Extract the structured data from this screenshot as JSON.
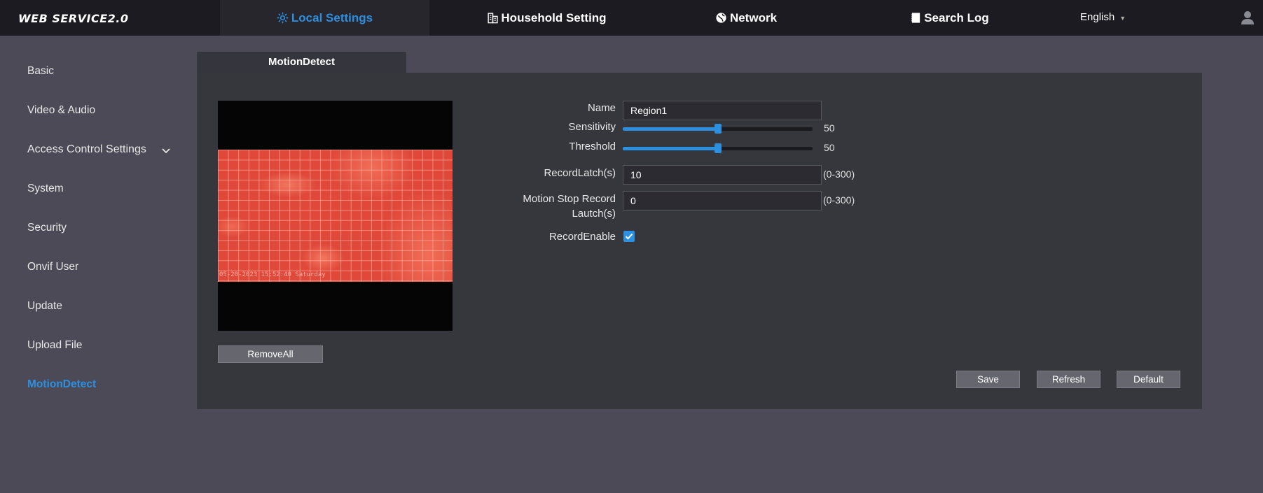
{
  "header": {
    "brand": "WEB SERVICE2.0",
    "nav": [
      {
        "label": "Local Settings",
        "icon": "gear-icon"
      },
      {
        "label": "Household Setting",
        "icon": "building-icon"
      },
      {
        "label": "Network",
        "icon": "globe-icon"
      },
      {
        "label": "Search Log",
        "icon": "document-icon"
      }
    ],
    "language": "English",
    "accent_color": "#2d8fe0"
  },
  "sidebar": {
    "items": [
      {
        "label": "Basic"
      },
      {
        "label": "Video & Audio"
      },
      {
        "label": "Access Control Settings"
      },
      {
        "label": "System"
      },
      {
        "label": "Security"
      },
      {
        "label": "Onvif User"
      },
      {
        "label": "Update"
      },
      {
        "label": "Upload File"
      },
      {
        "label": "MotionDetect"
      }
    ],
    "active": "MotionDetect"
  },
  "main": {
    "tab": "MotionDetect",
    "preview": {
      "overlay_text": "05-20-2023 15:52:40 Saturday"
    },
    "remove_all_label": "RemoveAll",
    "form": {
      "name_label": "Name",
      "name_value": "Region1",
      "sensitivity_label": "Sensitivity",
      "sensitivity_value": 50,
      "threshold_label": "Threshold",
      "threshold_value": 50,
      "record_latch_label": "RecordLatch(s)",
      "record_latch_value": "10",
      "record_latch_range": "(0-300)",
      "motion_stop_label_line1": "Motion Stop Record",
      "motion_stop_label_line2": "Lautch(s)",
      "motion_stop_value": "0",
      "motion_stop_range": "(0-300)",
      "record_enable_label": "RecordEnable",
      "record_enable_checked": true
    },
    "buttons": {
      "save": "Save",
      "refresh": "Refresh",
      "default": "Default"
    }
  }
}
